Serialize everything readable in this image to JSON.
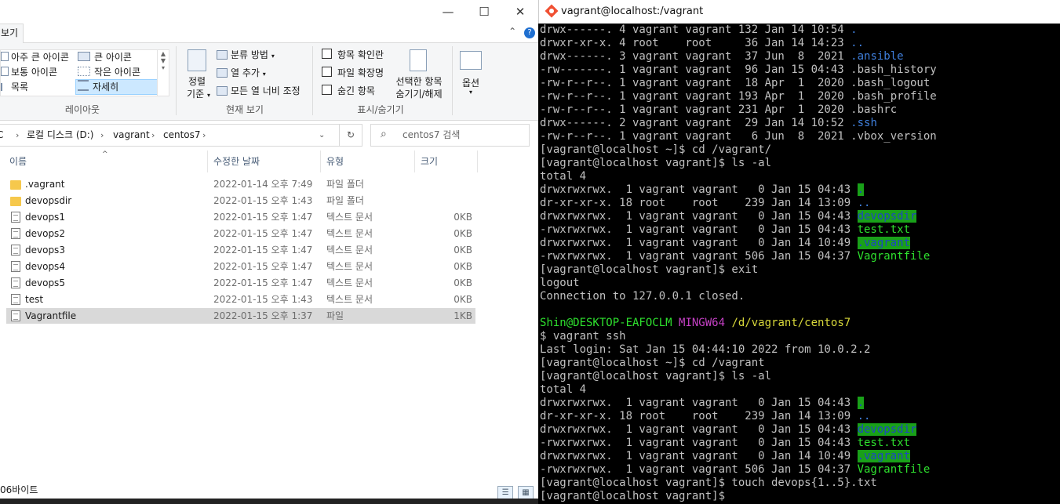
{
  "explorer": {
    "window_controls": [
      "—",
      "☐",
      "✕"
    ],
    "ribbon_tab_view": "보기",
    "ribbon_right": {
      "collapse": "⌃",
      "help": "?"
    },
    "layout": {
      "items": [
        {
          "label": "아주 큰 아이콘"
        },
        {
          "label": "큰 아이콘"
        },
        {
          "label": "보통 아이콘"
        },
        {
          "label": "작은 아이콘"
        },
        {
          "label": "목록"
        },
        {
          "label": "자세히"
        }
      ],
      "group_label": "레이아웃"
    },
    "current_view": {
      "sort_label_line1": "정렬",
      "sort_label_line2": "기준",
      "group_by": "분류 방법",
      "add_column": "열 추가",
      "fit_columns": "모든 열 너비 조정",
      "group_label": "현재 보기"
    },
    "show_hide": {
      "item_checkboxes": "항목 확인란",
      "file_extensions": "파일 확장명",
      "hidden_items": "숨긴 항목",
      "hide_selected_line1": "선택한 항목",
      "hide_selected_line2": "숨기기/해제",
      "group_label": "표시/숨기기"
    },
    "options": {
      "label": "옵션"
    },
    "address": {
      "crumbs": [
        "C",
        "로컬 디스크 (D:)",
        "vagrant",
        "centos7"
      ],
      "crumb_sep": "›"
    },
    "search": {
      "placeholder": "centos7 검색"
    },
    "columns": {
      "name": "이름",
      "modified": "수정한 날짜",
      "type": "유형",
      "size": "크기"
    },
    "files": [
      {
        "name": ".vagrant",
        "modified": "2022-01-14 오후 7:49",
        "type": "파일 폴더",
        "size": "",
        "icon": "folder-icon"
      },
      {
        "name": "devopsdir",
        "modified": "2022-01-15 오후 1:43",
        "type": "파일 폴더",
        "size": "",
        "icon": "folder-icon"
      },
      {
        "name": "devops1",
        "modified": "2022-01-15 오후 1:47",
        "type": "텍스트 문서",
        "size": "0KB",
        "icon": "text-file-icon"
      },
      {
        "name": "devops2",
        "modified": "2022-01-15 오후 1:47",
        "type": "텍스트 문서",
        "size": "0KB",
        "icon": "text-file-icon"
      },
      {
        "name": "devops3",
        "modified": "2022-01-15 오후 1:47",
        "type": "텍스트 문서",
        "size": "0KB",
        "icon": "text-file-icon"
      },
      {
        "name": "devops4",
        "modified": "2022-01-15 오후 1:47",
        "type": "텍스트 문서",
        "size": "0KB",
        "icon": "text-file-icon"
      },
      {
        "name": "devops5",
        "modified": "2022-01-15 오후 1:47",
        "type": "텍스트 문서",
        "size": "0KB",
        "icon": "text-file-icon"
      },
      {
        "name": "test",
        "modified": "2022-01-15 오후 1:43",
        "type": "텍스트 문서",
        "size": "0KB",
        "icon": "text-file-icon"
      },
      {
        "name": "Vagrantfile",
        "modified": "2022-01-15 오후 1:37",
        "type": "파일",
        "size": "1KB",
        "icon": "file-icon",
        "selected": true
      }
    ],
    "status_text": "06바이트"
  },
  "terminal": {
    "title": "vagrant@localhost:/vagrant",
    "lines": [
      [
        {
          "t": "drwx------. 4 vagrant vagrant 132 Jan 14 10:54 "
        },
        {
          "t": ".",
          "c": "blue"
        }
      ],
      [
        {
          "t": "drwxr-xr-x. 4 root    root     36 Jan 14 14:23 "
        },
        {
          "t": "..",
          "c": "blue"
        }
      ],
      [
        {
          "t": "drwx------. 3 vagrant vagrant  37 Jun  8  2021 "
        },
        {
          "t": ".ansible",
          "c": "blue"
        }
      ],
      [
        {
          "t": "-rw-------. 1 vagrant vagrant  96 Jan 15 04:43 .bash_history"
        }
      ],
      [
        {
          "t": "-rw-r--r--. 1 vagrant vagrant  18 Apr  1  2020 .bash_logout"
        }
      ],
      [
        {
          "t": "-rw-r--r--. 1 vagrant vagrant 193 Apr  1  2020 .bash_profile"
        }
      ],
      [
        {
          "t": "-rw-r--r--. 1 vagrant vagrant 231 Apr  1  2020 .bashrc"
        }
      ],
      [
        {
          "t": "drwx------. 2 vagrant vagrant  29 Jan 14 10:52 "
        },
        {
          "t": ".ssh",
          "c": "blue"
        }
      ],
      [
        {
          "t": "-rw-r--r--. 1 vagrant vagrant   6 Jun  8  2021 .vbox_version"
        }
      ],
      [
        {
          "t": "[vagrant@localhost ~]$ cd /vagrant/"
        }
      ],
      [
        {
          "t": "[vagrant@localhost vagrant]$ ls -al"
        }
      ],
      [
        {
          "t": "total 4"
        }
      ],
      [
        {
          "t": "drwxrwxrwx.  1 vagrant vagrant   0 Jan 15 04:43 "
        },
        {
          "t": ".",
          "c": "hi"
        }
      ],
      [
        {
          "t": "dr-xr-xr-x. 18 root    root    239 Jan 14 13:09 "
        },
        {
          "t": "..",
          "c": "blue"
        }
      ],
      [
        {
          "t": "drwxrwxrwx.  1 vagrant vagrant   0 Jan 15 04:43 "
        },
        {
          "t": "devopsdir",
          "c": "hi"
        }
      ],
      [
        {
          "t": "-rwxrwxrwx.  1 vagrant vagrant   0 Jan 15 04:43 "
        },
        {
          "t": "test.txt",
          "c": "green"
        }
      ],
      [
        {
          "t": "drwxrwxrwx.  1 vagrant vagrant   0 Jan 14 10:49 "
        },
        {
          "t": ".vagrant",
          "c": "hi"
        }
      ],
      [
        {
          "t": "-rwxrwxrwx.  1 vagrant vagrant 506 Jan 15 04:37 "
        },
        {
          "t": "Vagrantfile",
          "c": "green"
        }
      ],
      [
        {
          "t": "[vagrant@localhost vagrant]$ exit"
        }
      ],
      [
        {
          "t": "logout"
        }
      ],
      [
        {
          "t": "Connection to 127.0.0.1 closed."
        }
      ],
      [
        {
          "t": ""
        }
      ],
      [
        {
          "t": "Shin@DESKTOP-EAFOCLM",
          "c": "green"
        },
        {
          "t": " "
        },
        {
          "t": "MINGW64",
          "c": "magenta"
        },
        {
          "t": " "
        },
        {
          "t": "/d/vagrant/centos7",
          "c": "yellow"
        }
      ],
      [
        {
          "t": "$ vagrant ssh"
        }
      ],
      [
        {
          "t": "Last login: Sat Jan 15 04:44:10 2022 from 10.0.2.2"
        }
      ],
      [
        {
          "t": "[vagrant@localhost ~]$ cd /vagrant"
        }
      ],
      [
        {
          "t": "[vagrant@localhost vagrant]$ ls -al"
        }
      ],
      [
        {
          "t": "total 4"
        }
      ],
      [
        {
          "t": "drwxrwxrwx.  1 vagrant vagrant   0 Jan 15 04:43 "
        },
        {
          "t": ".",
          "c": "hi"
        }
      ],
      [
        {
          "t": "dr-xr-xr-x. 18 root    root    239 Jan 14 13:09 "
        },
        {
          "t": "..",
          "c": "blue"
        }
      ],
      [
        {
          "t": "drwxrwxrwx.  1 vagrant vagrant   0 Jan 15 04:43 "
        },
        {
          "t": "devopsdir",
          "c": "hi"
        }
      ],
      [
        {
          "t": "-rwxrwxrwx.  1 vagrant vagrant   0 Jan 15 04:43 "
        },
        {
          "t": "test.txt",
          "c": "green"
        }
      ],
      [
        {
          "t": "drwxrwxrwx.  1 vagrant vagrant   0 Jan 14 10:49 "
        },
        {
          "t": ".vagrant",
          "c": "hi"
        }
      ],
      [
        {
          "t": "-rwxrwxrwx.  1 vagrant vagrant 506 Jan 15 04:37 "
        },
        {
          "t": "Vagrantfile",
          "c": "green"
        }
      ],
      [
        {
          "t": "[vagrant@localhost vagrant]$ touch devops{1..5}.txt"
        }
      ],
      [
        {
          "t": "[vagrant@localhost vagrant]$"
        }
      ]
    ]
  },
  "colors": {
    "terminal_bg": "#000000",
    "terminal_fg": "#c0c0c0",
    "dir_blue": "#3f7fdc",
    "exec_green": "#2ee02e",
    "highlight_bg": "#19a019",
    "selection": "#d9d9d9"
  }
}
